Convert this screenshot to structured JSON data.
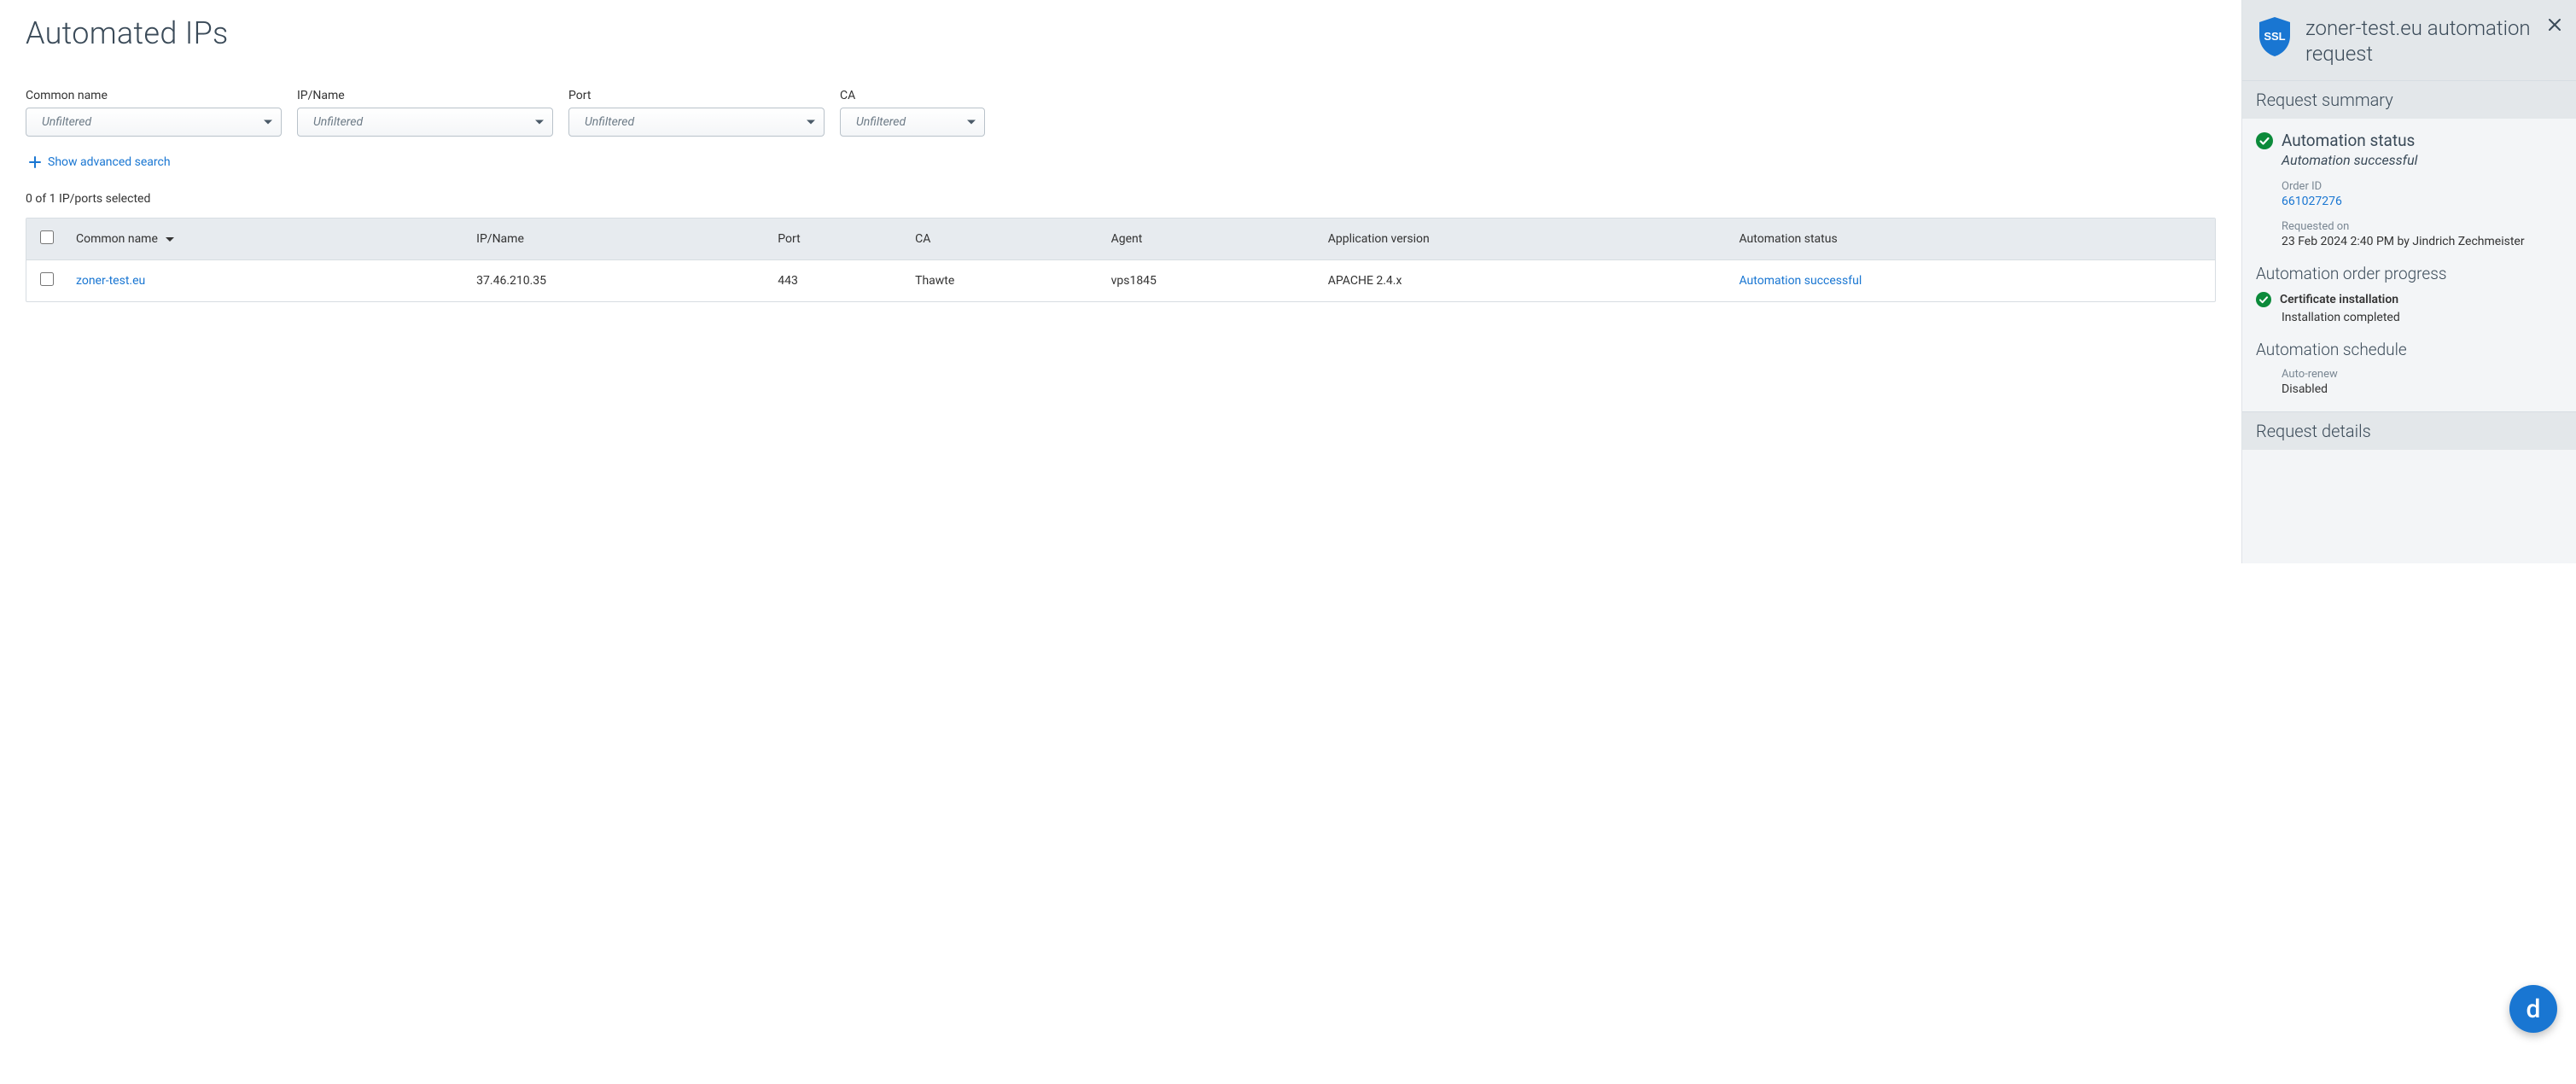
{
  "page": {
    "title": "Automated IPs"
  },
  "filters": [
    {
      "label": "Common name",
      "placeholder": "Unfiltered"
    },
    {
      "label": "IP/Name",
      "placeholder": "Unfiltered"
    },
    {
      "label": "Port",
      "placeholder": "Unfiltered"
    },
    {
      "label": "CA",
      "placeholder": "Unfiltered"
    }
  ],
  "advanced_search_label": "Show advanced search",
  "selection_text": "0 of 1 IP/ports selected",
  "table": {
    "headers": {
      "common_name": "Common name",
      "ip_name": "IP/Name",
      "port": "Port",
      "ca": "CA",
      "agent": "Agent",
      "app_version": "Application version",
      "automation_status": "Automation status"
    },
    "rows": [
      {
        "common_name": "zoner-test.eu",
        "ip_name": "37.46.210.35",
        "port": "443",
        "ca": "Thawte",
        "agent": "vps1845",
        "app_version": "APACHE 2.4.x",
        "automation_status": "Automation successful"
      }
    ]
  },
  "panel": {
    "title": "zoner-test.eu automation request",
    "request_summary_heading": "Request summary",
    "automation_status_label": "Automation status",
    "automation_status_value": "Automation successful",
    "order_id_label": "Order ID",
    "order_id_value": "661027276",
    "requested_on_label": "Requested on",
    "requested_on_value": "23 Feb 2024 2:40 PM by Jindrich Zechmeister",
    "order_progress_heading": "Automation order progress",
    "cert_install_label": "Certificate installation",
    "cert_install_status": "Installation completed",
    "schedule_heading": "Automation schedule",
    "auto_renew_label": "Auto-renew",
    "auto_renew_value": "Disabled",
    "request_details_heading": "Request details"
  },
  "fab_letter": "d"
}
